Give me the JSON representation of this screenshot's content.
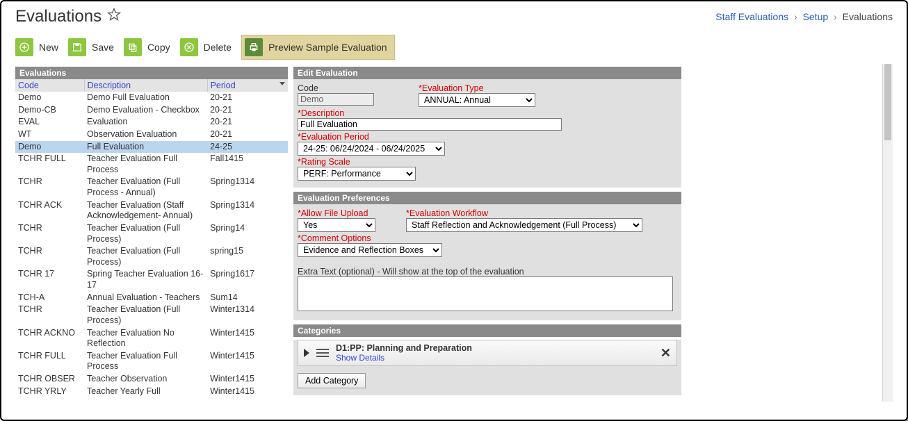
{
  "header": {
    "title": "Evaluations",
    "breadcrumb": [
      "Staff Evaluations",
      "Setup",
      "Evaluations"
    ]
  },
  "toolbar": {
    "new_label": "New",
    "save_label": "Save",
    "copy_label": "Copy",
    "delete_label": "Delete",
    "preview_label": "Preview Sample Evaluation"
  },
  "left": {
    "panel_title": "Evaluations",
    "columns": {
      "code": "Code",
      "description": "Description",
      "period": "Period"
    },
    "rows": [
      {
        "code": "Demo",
        "desc": "Demo Full Evaluation",
        "period": "20-21",
        "selected": false
      },
      {
        "code": "Demo-CB",
        "desc": "Demo Evaluation - Checkbox",
        "period": "20-21",
        "selected": false
      },
      {
        "code": "EVAL",
        "desc": "Evaluation",
        "period": "20-21",
        "selected": false
      },
      {
        "code": "WT",
        "desc": "Observation Evaluation",
        "period": "20-21",
        "selected": false
      },
      {
        "code": "Demo",
        "desc": "Full Evaluation",
        "period": "24-25",
        "selected": true
      },
      {
        "code": "TCHR FULL",
        "desc": "Teacher Evaluation Full Process",
        "period": "Fall1415",
        "selected": false
      },
      {
        "code": "TCHR",
        "desc": "Teacher Evaluation (Full Process - Annual)",
        "period": "Spring1314",
        "selected": false
      },
      {
        "code": "TCHR ACK",
        "desc": "Teacher Evaluation (Staff Acknowledgement- Annual)",
        "period": "Spring1314",
        "selected": false
      },
      {
        "code": "TCHR",
        "desc": "Teacher Evaluation (Full Process)",
        "period": "Spring14",
        "selected": false
      },
      {
        "code": "TCHR",
        "desc": "Teacher Evaluation (Full Process)",
        "period": "spring15",
        "selected": false
      },
      {
        "code": "TCHR 17",
        "desc": "Spring Teacher Evaluation 16-17",
        "period": "Spring1617",
        "selected": false
      },
      {
        "code": "TCH-A",
        "desc": "Annual Evaluation - Teachers",
        "period": "Sum14",
        "selected": false
      },
      {
        "code": "TCHR",
        "desc": "Teacher Evaluation (Full Process)",
        "period": "Winter1314",
        "selected": false
      },
      {
        "code": "TCHR ACKNO",
        "desc": "Teacher Evaluation No Reflection",
        "period": "Winter1415",
        "selected": false
      },
      {
        "code": "TCHR FULL",
        "desc": "Teacher Evaluation Full Process",
        "period": "Winter1415",
        "selected": false
      },
      {
        "code": "TCHR OBSER",
        "desc": "Teacher Observation",
        "period": "Winter1415",
        "selected": false
      },
      {
        "code": "TCHR YRLY",
        "desc": "Teacher Yearly Full",
        "period": "Winter1415",
        "selected": false
      }
    ]
  },
  "edit": {
    "panel_title": "Edit Evaluation",
    "code_label": "Code",
    "code_value": "Demo",
    "type_label": "*Evaluation Type",
    "type_value": "ANNUAL: Annual",
    "desc_label": "*Description",
    "desc_value": "Full Evaluation",
    "period_label": "*Evaluation Period",
    "period_value": "24-25: 06/24/2024 - 06/24/2025",
    "rating_label": "*Rating Scale",
    "rating_value": "PERF: Performance"
  },
  "prefs": {
    "panel_title": "Evaluation Preferences",
    "upload_label": "*Allow File Upload",
    "upload_value": "Yes",
    "workflow_label": "*Evaluation Workflow",
    "workflow_value": "Staff Reflection and Acknowledgement (Full Process)",
    "comment_label": "*Comment Options",
    "comment_value": "Evidence and Reflection Boxes",
    "extra_text_label": "Extra Text (optional) - Will show at the top of the evaluation",
    "extra_text_value": ""
  },
  "categories": {
    "panel_title": "Categories",
    "item_title": "D1:PP: Planning and Preparation",
    "show_details": "Show Details",
    "add_label": "Add Category"
  }
}
